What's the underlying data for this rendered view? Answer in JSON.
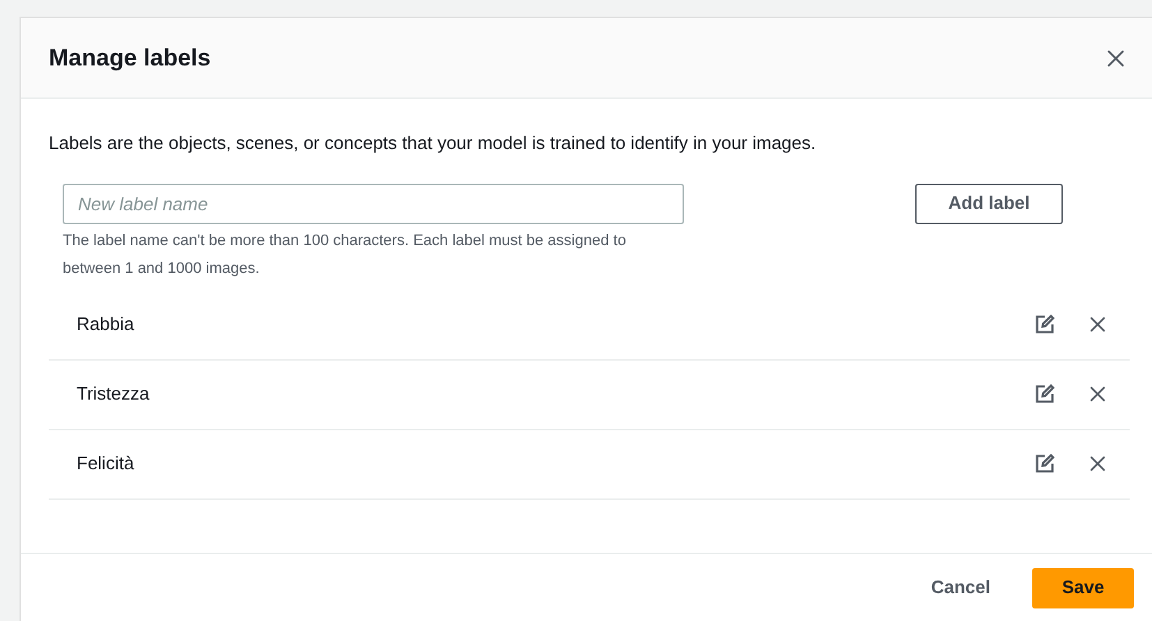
{
  "dialog": {
    "title": "Manage labels",
    "description": "Labels are the objects, scenes, or concepts that your model is trained to identify in your images.",
    "new_label": {
      "placeholder": "New label name",
      "help": "The label name can't be more than 100 characters. Each label must be assigned to between 1 and 1000 images.",
      "button": "Add label"
    },
    "labels": [
      {
        "name": "Rabbia"
      },
      {
        "name": "Tristezza"
      },
      {
        "name": "Felicità"
      }
    ],
    "buttons": [
      {
        "label": "Cancel",
        "kind": "link"
      },
      {
        "label": "Save",
        "kind": "primary"
      }
    ]
  }
}
